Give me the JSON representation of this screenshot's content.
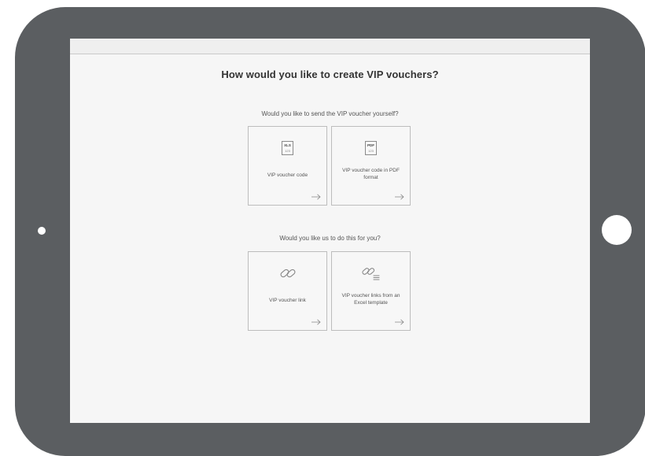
{
  "heading": "How would you like to create VIP vouchers?",
  "section_self": {
    "question": "Would you like to send the VIP voucher yourself?",
    "options": [
      {
        "label": "VIP voucher code",
        "icon": "xls-file-icon",
        "icon_type": "XLS",
        "icon_sub": "123"
      },
      {
        "label": "VIP voucher code in PDF format",
        "icon": "pdf-file-icon",
        "icon_type": "PDF",
        "icon_sub": "123"
      }
    ]
  },
  "section_service": {
    "question": "Would you like us to do this for you?",
    "options": [
      {
        "label": "VIP voucher link",
        "icon": "link-icon"
      },
      {
        "label": "VIP voucher links from an Excel template",
        "icon": "link-list-icon"
      }
    ]
  },
  "colors": {
    "device_frame": "#5b5e61",
    "screen_background": "#f6f6f6",
    "card_border": "#bdbdbd",
    "text": "#555555",
    "heading": "#333333"
  }
}
